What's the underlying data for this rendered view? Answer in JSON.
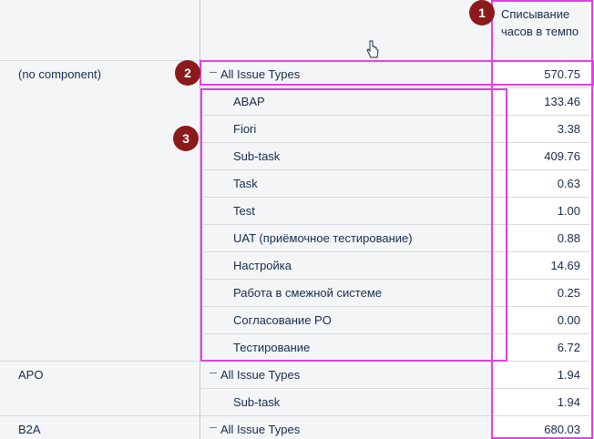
{
  "header": {
    "column_title": "Списывание часов в темпо"
  },
  "badges": [
    "1",
    "2",
    "3"
  ],
  "rows": [
    {
      "component": "(no component)",
      "type": "All Issue Types",
      "value": "570.75",
      "collapsible": true
    },
    {
      "component": "",
      "type": "ABAP",
      "value": "133.46",
      "collapsible": false
    },
    {
      "component": "",
      "type": "Fiori",
      "value": "3.38",
      "collapsible": false
    },
    {
      "component": "",
      "type": "Sub-task",
      "value": "409.76",
      "collapsible": false
    },
    {
      "component": "",
      "type": "Task",
      "value": "0.63",
      "collapsible": false
    },
    {
      "component": "",
      "type": "Test",
      "value": "1.00",
      "collapsible": false
    },
    {
      "component": "",
      "type": "UAT (приёмочное тестирование)",
      "value": "0.88",
      "collapsible": false
    },
    {
      "component": "",
      "type": "Настройка",
      "value": "14.69",
      "collapsible": false
    },
    {
      "component": "",
      "type": "Работа в смежной системе",
      "value": "0.25",
      "collapsible": false
    },
    {
      "component": "",
      "type": "Согласование PO",
      "value": "0.00",
      "collapsible": false
    },
    {
      "component": "",
      "type": "Тестирование",
      "value": "6.72",
      "collapsible": false
    },
    {
      "component": "APO",
      "type": "All Issue Types",
      "value": "1.94",
      "collapsible": true
    },
    {
      "component": "",
      "type": "Sub-task",
      "value": "1.94",
      "collapsible": false
    },
    {
      "component": "B2A",
      "type": "All Issue Types",
      "value": "680.03",
      "collapsible": true
    }
  ]
}
